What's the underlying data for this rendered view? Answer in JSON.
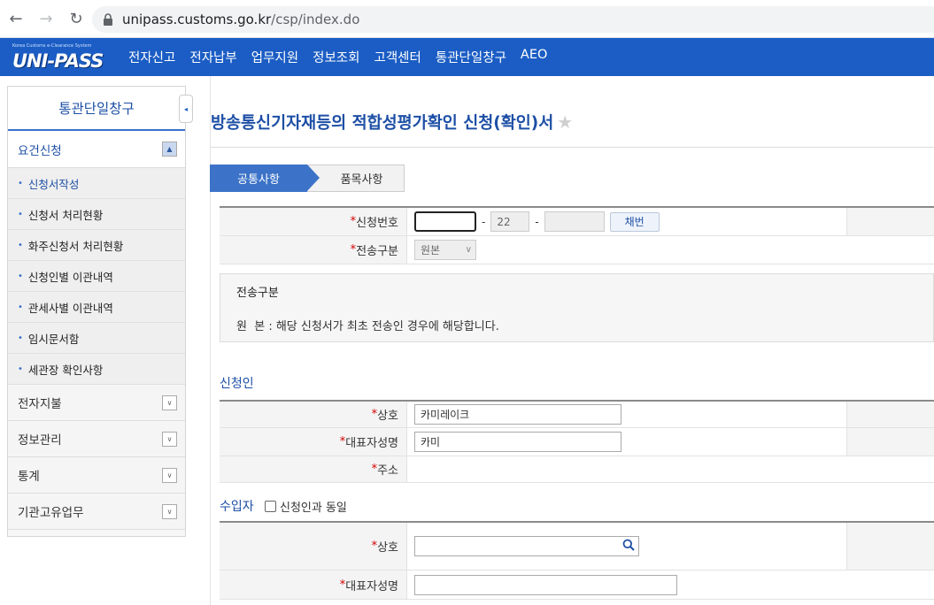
{
  "browser": {
    "url_domain": "unipass.customs.go.kr",
    "url_path": "/csp/index.do",
    "back_glyph": "←",
    "forward_glyph": "→",
    "reload_glyph": "↻"
  },
  "header": {
    "logo_small": "Korea Customs e-Clearance System",
    "logo_main": "UNI-PASS",
    "menu": [
      "전자신고",
      "전자납부",
      "업무지원",
      "정보조회",
      "고객센터",
      "통관단일창구",
      "AEO"
    ]
  },
  "sidebar": {
    "title": "통관단일창구",
    "collapse_glyph": "◂",
    "open_group": "요건신청",
    "items": [
      "신청서작성",
      "신청서 처리현황",
      "화주신청서 처리현황",
      "신청인별 이관내역",
      "관세사별 이관내역",
      "임시문서함",
      "세관장 확인사항"
    ],
    "groups": [
      "전자지불",
      "정보관리",
      "통계",
      "기관고유업무"
    ],
    "toggle_up": "▲",
    "toggle_down": "∨"
  },
  "main": {
    "title": "방송통신기자재등의 적합성평가확인 신청(확인)서",
    "star": "★",
    "tabs": [
      "공통사항",
      "품목사항"
    ],
    "app_number": {
      "label": "신청번호",
      "field1": "",
      "field2": "22",
      "field3": "",
      "button": "채번",
      "dash": "-"
    },
    "transmission": {
      "label": "전송구분",
      "value": "원본"
    },
    "info": {
      "title": "전송구분",
      "text": "원  본 : 해당 신청서가 최초 전송인 경우에 해당합니다."
    },
    "applicant": {
      "section": "신청인",
      "company_label": "상호",
      "company_value": "카미레이크",
      "rep_label": "대표자성명",
      "rep_value": "카미",
      "address_label": "주소"
    },
    "importer": {
      "section": "수입자",
      "same_as_label": "신청인과 동일",
      "company_label": "상호",
      "company_value": "",
      "rep_label": "대표자성명",
      "rep_value": ""
    },
    "required_mark": "*"
  }
}
